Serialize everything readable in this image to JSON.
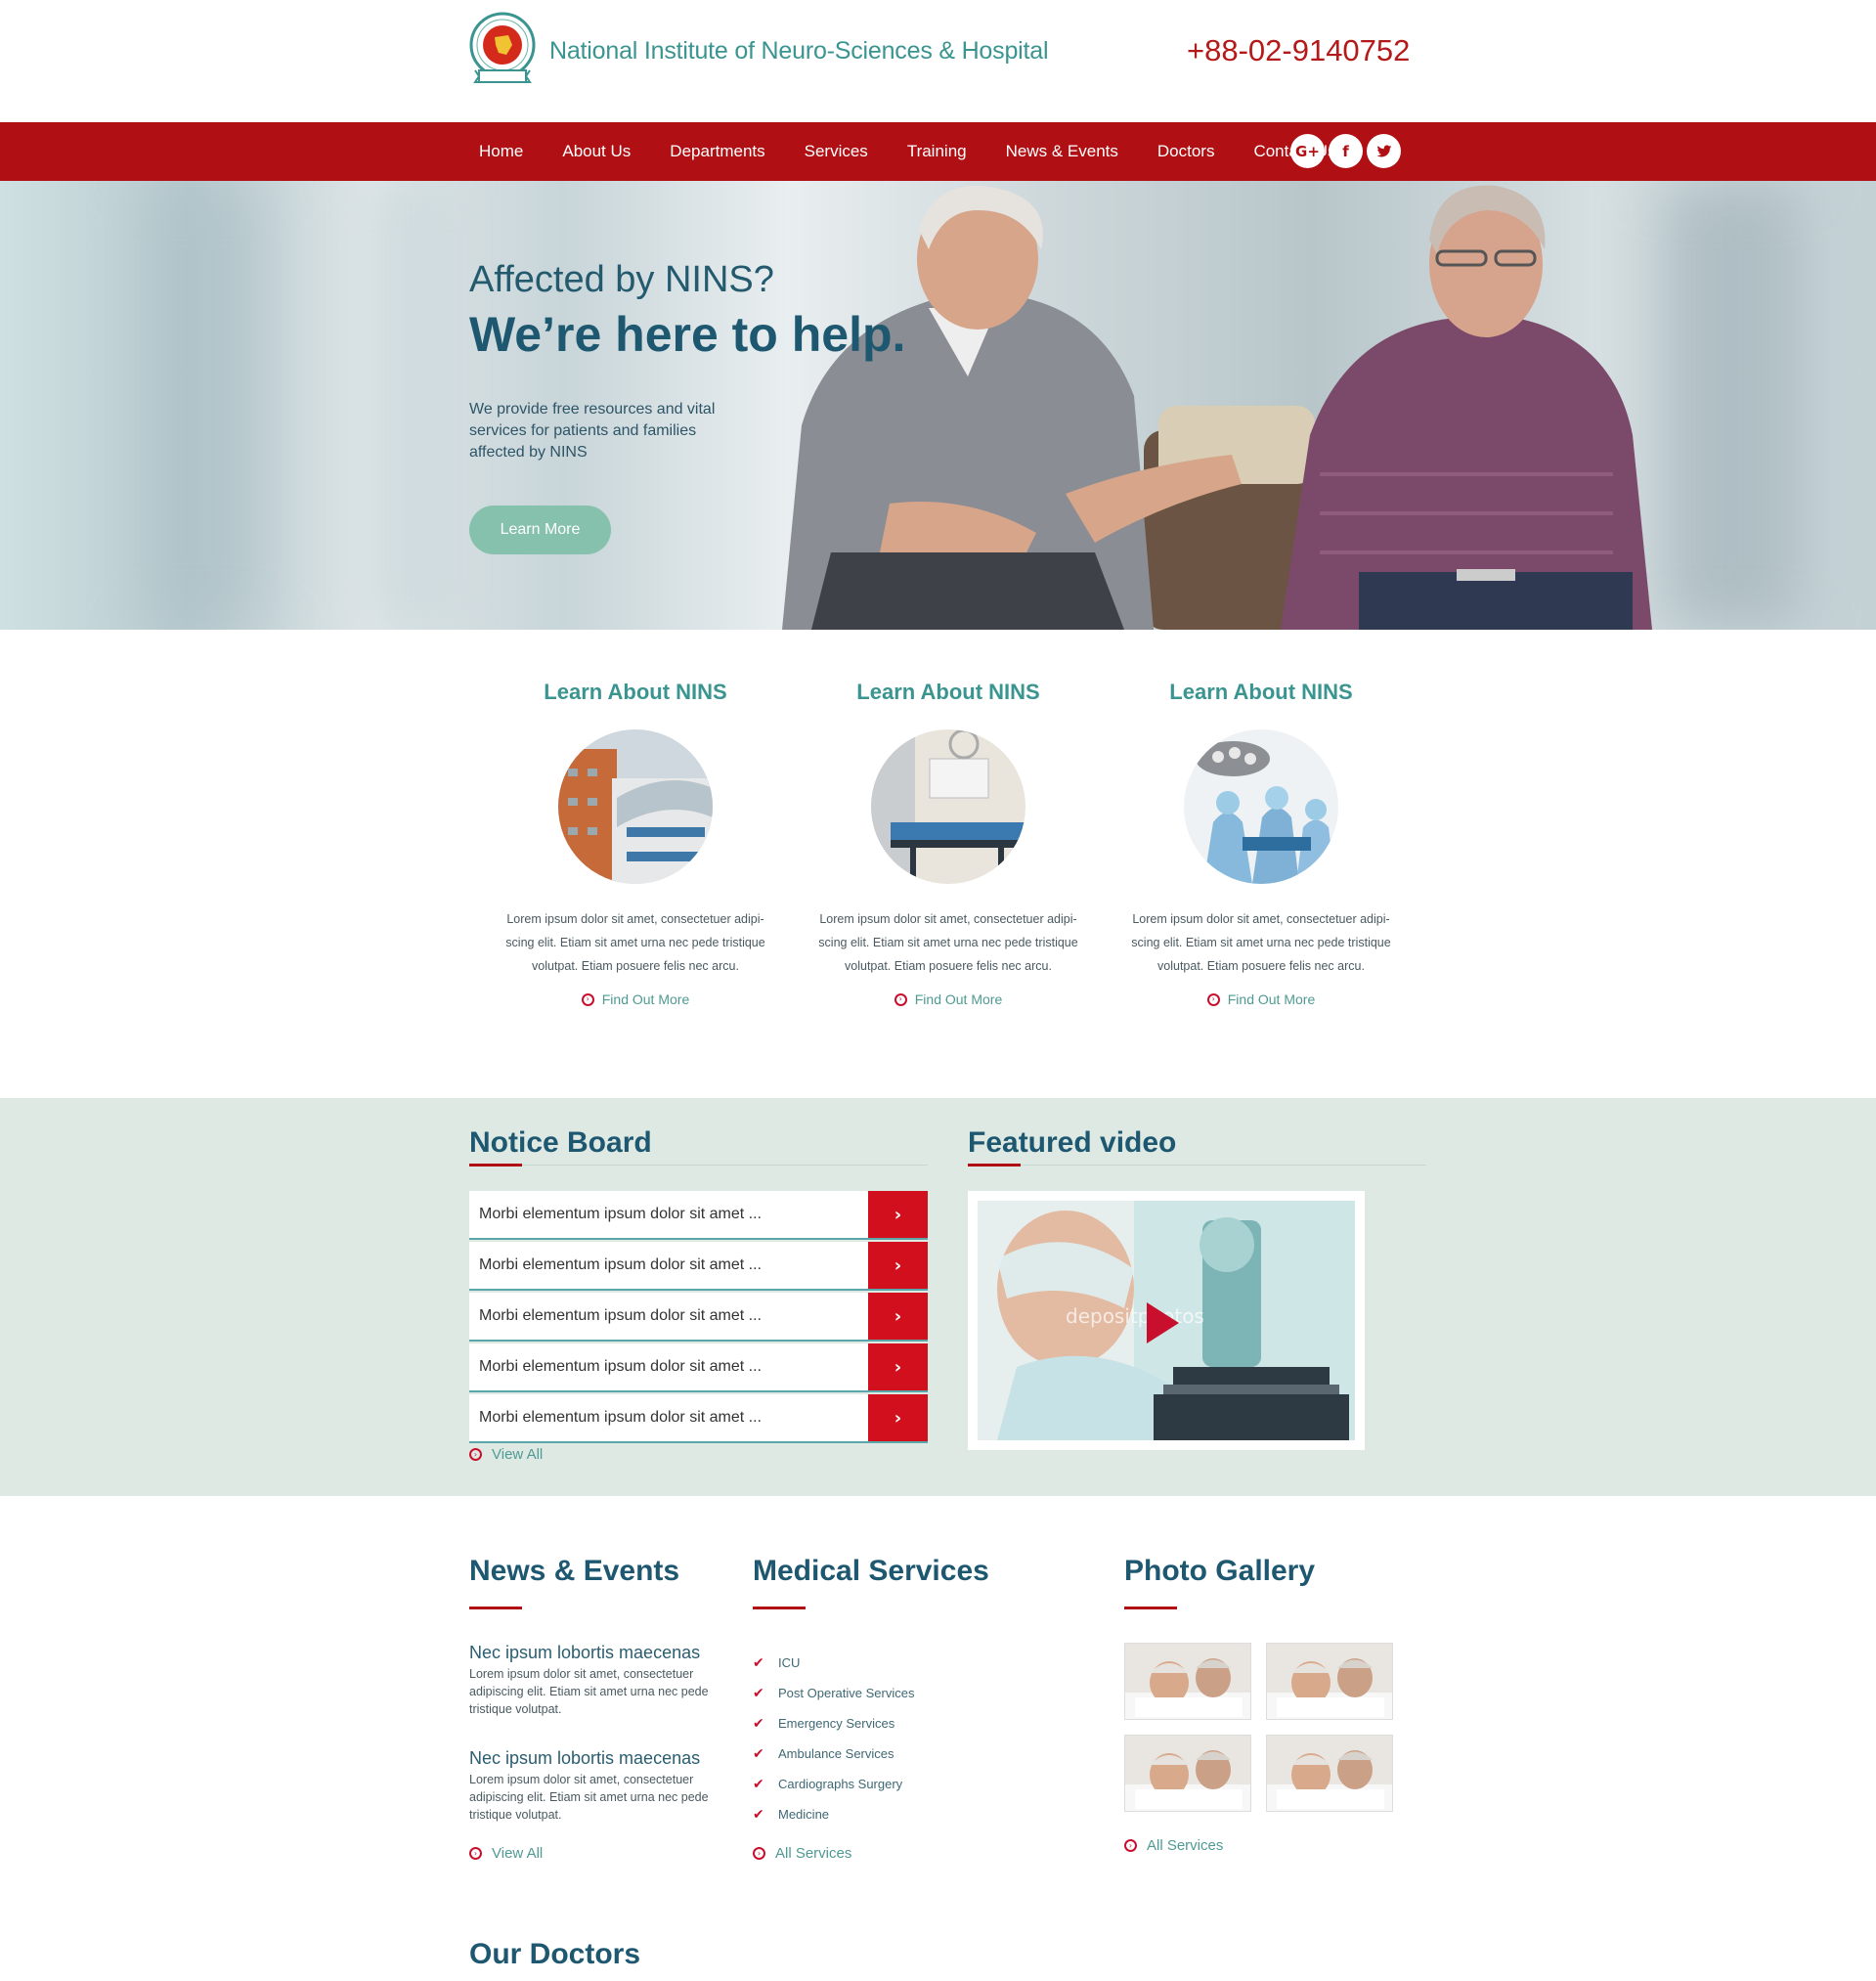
{
  "header": {
    "site_name": "National Institute of Neuro-Sciences & Hospital",
    "phone": "+88-02-9140752"
  },
  "nav": {
    "items": [
      "Home",
      "About Us",
      "Departments",
      "Services",
      "Training",
      "News & Events",
      "Doctors",
      "Contact Us"
    ],
    "social": [
      "G+",
      "f",
      "t"
    ]
  },
  "hero": {
    "subtitle": "Affected by NINS?",
    "title": "We’re here to help.",
    "description": "We provide free resources and vital services for patients and families affected by NINS",
    "button": "Learn More"
  },
  "learn": {
    "columns": [
      {
        "title": "Learn About NINS",
        "text": "Lorem ipsum dolor sit amet, consectetuer adipi-scing elit. Etiam sit amet urna nec pede tristique volutpat. Etiam posuere felis nec arcu.",
        "link": "Find Out More",
        "image": "hospital-building"
      },
      {
        "title": "Learn About NINS",
        "text": "Lorem ipsum dolor sit amet, consectetuer adipi-scing elit. Etiam sit amet urna nec pede tristique volutpat. Etiam posuere felis nec arcu.",
        "link": "Find Out More",
        "image": "ward-beds"
      },
      {
        "title": "Learn About NINS",
        "text": "Lorem ipsum dolor sit amet, consectetuer adipi-scing elit. Etiam sit amet urna nec pede tristique volutpat. Etiam posuere felis nec arcu.",
        "link": "Find Out More",
        "image": "operating-room"
      }
    ]
  },
  "notice": {
    "title": "Notice Board",
    "items": [
      "Morbi elementum ipsum dolor sit amet ...",
      "Morbi elementum ipsum dolor sit amet ...",
      "Morbi elementum ipsum dolor sit amet ...",
      "Morbi elementum ipsum dolor sit amet ...",
      "Morbi elementum ipsum dolor sit amet ..."
    ],
    "view_all": "View All"
  },
  "video": {
    "title": "Featured video",
    "watermark": "depositphotos"
  },
  "news": {
    "title": "News & Events",
    "items": [
      {
        "heading": "Nec ipsum lobortis maecenas",
        "text": "Lorem ipsum dolor sit amet, consectetuer adipiscing elit. Etiam sit amet urna nec pede tristique volutpat."
      },
      {
        "heading": "Nec ipsum lobortis maecenas",
        "text": "Lorem ipsum dolor sit amet, consectetuer adipiscing elit. Etiam sit amet urna nec pede tristique volutpat."
      }
    ],
    "view_all": "View All"
  },
  "medical": {
    "title": "Medical Services",
    "items": [
      "ICU",
      "Post Operative Services",
      "Emergency Services",
      "Ambulance Services",
      "Cardiographs Surgery",
      "Medicine"
    ],
    "all": "All Services"
  },
  "gallery": {
    "title": "Photo Gallery",
    "all": "All Services"
  },
  "doctors": {
    "title": "Our Doctors"
  },
  "colors": {
    "brand_red": "#b01014",
    "teal": "#3a9490",
    "navy": "#1e5870",
    "band_bg": "#dfe9e4"
  }
}
